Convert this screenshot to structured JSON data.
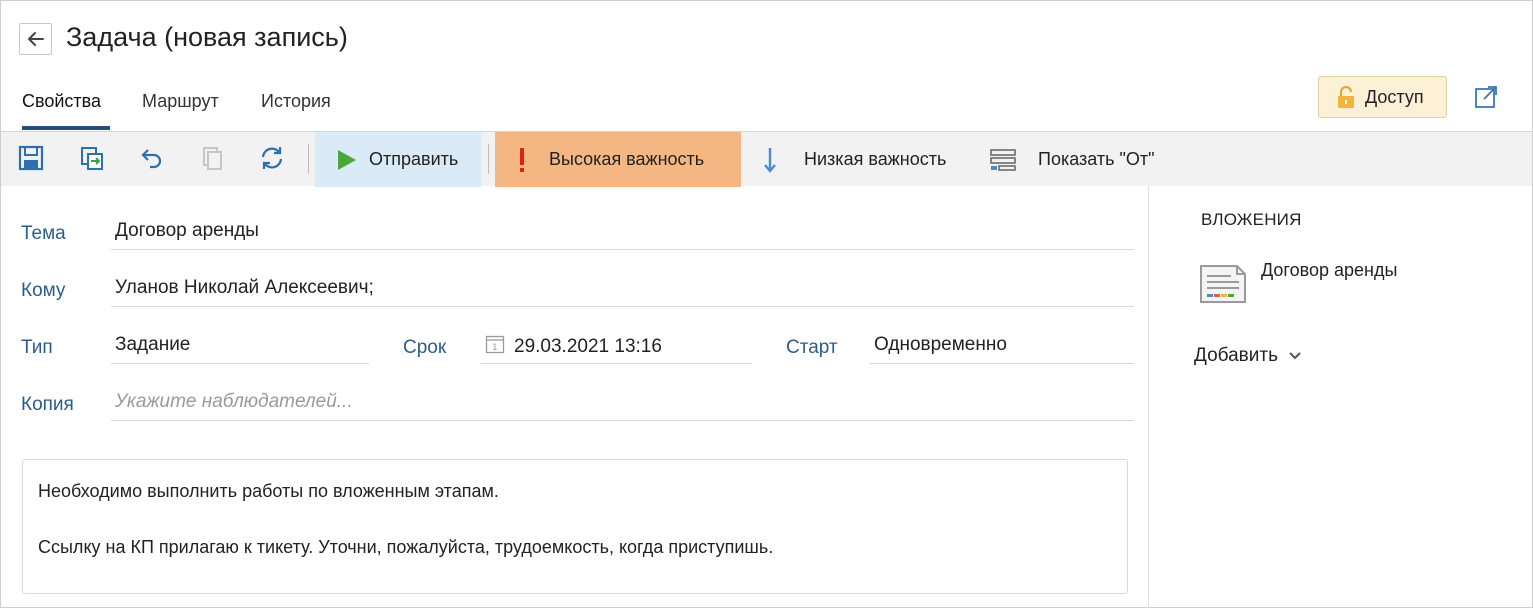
{
  "header": {
    "title": "Задача (новая запись)"
  },
  "tabs": [
    {
      "label": "Свойства",
      "active": true
    },
    {
      "label": "Маршрут",
      "active": false
    },
    {
      "label": "История",
      "active": false
    }
  ],
  "access_button": {
    "label": "Доступ",
    "icon": "lock-icon"
  },
  "toolbar": {
    "send_label": "Отправить",
    "high_importance_label": "Высокая важность",
    "low_importance_label": "Низкая важность",
    "show_from_label": "Показать \"От\"",
    "icons": [
      "save-icon",
      "save-and-close-icon",
      "undo-icon",
      "copy-icon",
      "refresh-icon"
    ]
  },
  "form": {
    "subject": {
      "label": "Тема",
      "value": "Договор аренды"
    },
    "to": {
      "label": "Кому",
      "value": "Уланов Николай Алексеевич;"
    },
    "type": {
      "label": "Тип",
      "value": "Задание"
    },
    "deadline": {
      "label": "Срок",
      "value": "29.03.2021 13:16"
    },
    "start": {
      "label": "Старт",
      "value": "Одновременно"
    },
    "copy": {
      "label": "Копия",
      "placeholder": "Укажите наблюдателей..."
    }
  },
  "body": {
    "paragraphs": [
      "Необходимо выполнить работы по вложенным этапам.",
      "Ссылку на КП прилагаю к тикету. Уточни, пожалуйста, трудоемкость, когда приступишь."
    ]
  },
  "attachments": {
    "title": "ВЛОЖЕНИЯ",
    "items": [
      {
        "name": "Договор аренды"
      }
    ],
    "add_label": "Добавить"
  },
  "colors": {
    "accent": "#234f7a",
    "label_blue": "#2b5d8c",
    "send_bg": "#dbeaf7",
    "high_importance_bg": "#f4b784",
    "access_bg": "#fcf0d6",
    "toolbar_bg": "#f2f2f2"
  }
}
